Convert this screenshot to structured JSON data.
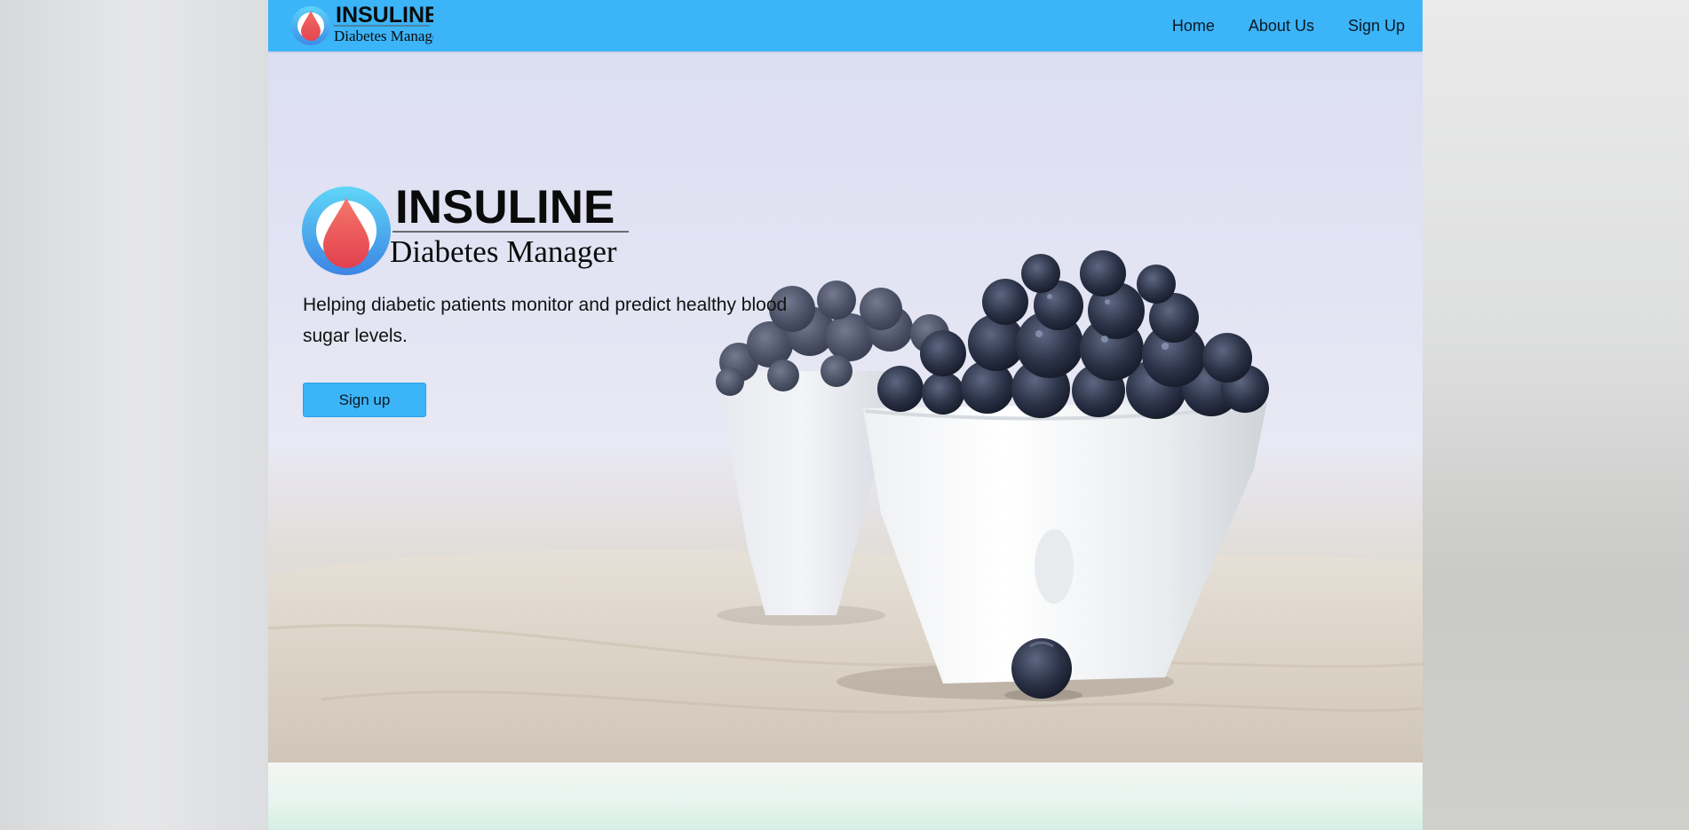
{
  "brand": {
    "name": "INSULINE",
    "subtitle": "Diabetes Manager"
  },
  "nav": {
    "links": [
      "Home",
      "About Us",
      "Sign Up"
    ]
  },
  "hero": {
    "tagline": "Helping diabetic patients monitor and predict healthy blood sugar levels.",
    "cta_label": "Sign up"
  },
  "icons": {
    "logo": "blood-drop-icon"
  },
  "colors": {
    "primary": "#3cb4f8",
    "drop": "#ee5a5c",
    "text": "#111111"
  }
}
